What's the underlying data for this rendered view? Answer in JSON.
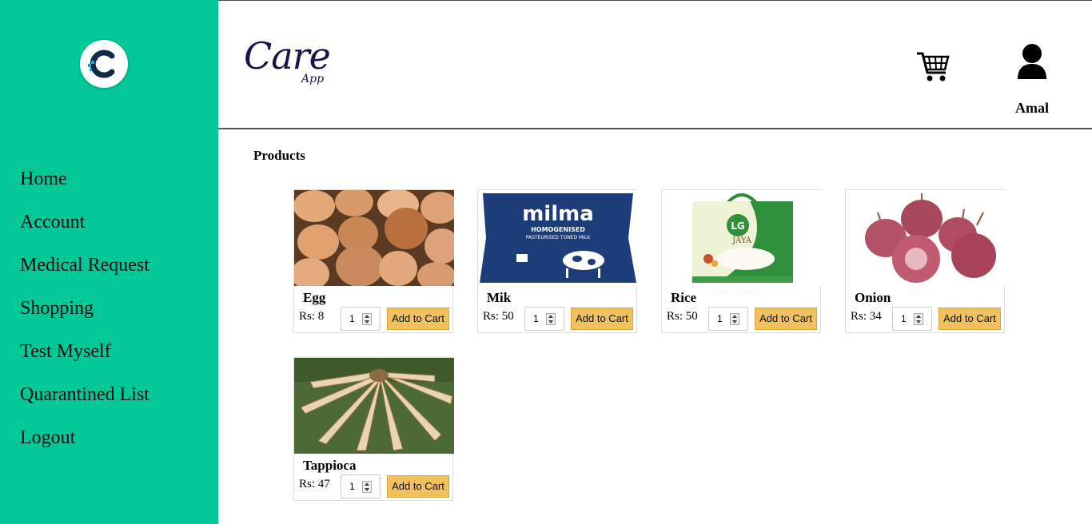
{
  "sidebar": {
    "logo_letter": "C",
    "items": [
      {
        "label": "Home"
      },
      {
        "label": "Account"
      },
      {
        "label": "Medical Request"
      },
      {
        "label": "Shopping"
      },
      {
        "label": "Test Myself"
      },
      {
        "label": "Quarantined List"
      },
      {
        "label": "Logout"
      }
    ]
  },
  "header": {
    "brand_main": "Care",
    "brand_sub": "App",
    "cart_icon": "shopping-cart-icon",
    "user_icon": "user-icon",
    "user_name": "Amal"
  },
  "main": {
    "title": "Products",
    "add_label": "Add to Cart",
    "products": [
      {
        "name": "Egg",
        "price": "Rs: 8",
        "qty": "1"
      },
      {
        "name": "Mik",
        "price": "Rs: 50",
        "qty": "1"
      },
      {
        "name": "Rice",
        "price": "Rs: 50",
        "qty": "1"
      },
      {
        "name": "Onion",
        "price": "Rs: 34",
        "qty": "1"
      },
      {
        "name": "Tappioca",
        "price": "Rs: 47",
        "qty": "1"
      }
    ]
  },
  "package_text": {
    "milk_brand": "milma",
    "milk_line1": "HOMOGENISED",
    "milk_line2": "PASTEURISED TONED MILK",
    "rice_brand": "LG",
    "rice_variety": "JAYA"
  },
  "colors": {
    "sidebar_bg": "#02c797",
    "button_bg": "#f0c15d",
    "brand": "#1d1147"
  }
}
